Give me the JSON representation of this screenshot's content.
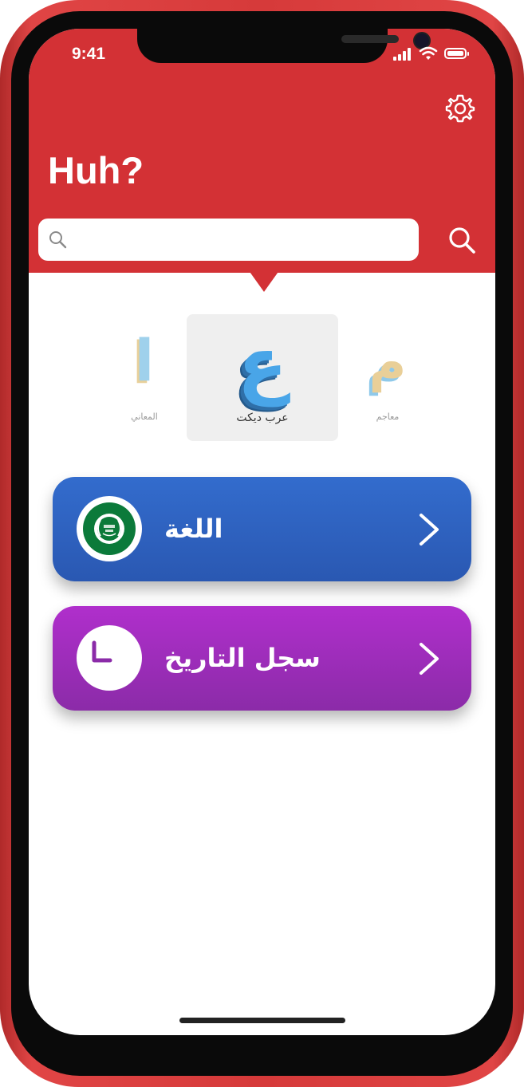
{
  "status_bar": {
    "time": "9:41"
  },
  "header": {
    "title": "Huh?",
    "search_placeholder": "",
    "background_color": "#d33135"
  },
  "icons": {
    "settings": "gear-icon",
    "search_small": "magnifier-icon",
    "search_button": "magnifier-icon",
    "chevron": "chevron-right-icon",
    "flag": "arab-league-flag-icon",
    "clock": "clock-icon"
  },
  "carousel": {
    "items": [
      {
        "glyph": "ا",
        "label": "المعاني",
        "selected": false
      },
      {
        "glyph": "ع",
        "label": "عرب ديكت",
        "selected": true
      },
      {
        "glyph": "م",
        "label": "معاجم",
        "selected": false
      }
    ]
  },
  "menu": {
    "items": [
      {
        "label": "اللغة",
        "color": "#2f62c1",
        "icon": "arab-league-flag-icon"
      },
      {
        "label": "سجل التاريخ",
        "color": "#a22dbf",
        "icon": "clock-icon"
      }
    ]
  },
  "colors": {
    "frame": "#d63a3a",
    "accent_blue": "#49a5e8",
    "language_button": "#2f62c1",
    "history_button": "#a22dbf"
  }
}
